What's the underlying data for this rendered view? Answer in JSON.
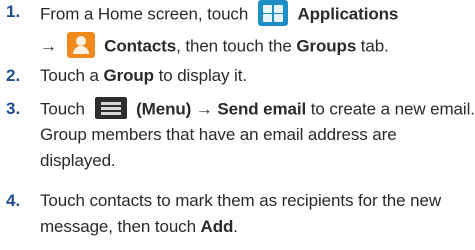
{
  "steps": [
    {
      "number": "1.",
      "line1": {
        "t1": "From a Home screen, touch",
        "b1": "Applications"
      },
      "line2": {
        "arrow": "→",
        "b1": "Contacts",
        "t1": ", then touch the ",
        "b2": "Groups",
        "t2": " tab."
      }
    },
    {
      "number": "2.",
      "line1": {
        "t1": "Touch a ",
        "b1": "Group",
        "t2": " to display it."
      }
    },
    {
      "number": "3.",
      "line1": {
        "t1": "Touch ",
        "b1": "(Menu)",
        "arrow": " → ",
        "b2": "Send email",
        "t2": " to create a new email."
      },
      "line2": "Group members that have an email address are",
      "line3": "displayed."
    },
    {
      "number": "4.",
      "line1": "Touch contacts to mark them as recipients for the new",
      "line2": {
        "t1": "message, then touch ",
        "b1": "Add",
        "t2": "."
      }
    }
  ],
  "icons": {
    "applications": "applications-icon",
    "contacts": "contacts-icon",
    "menu": "menu-icon"
  },
  "colors": {
    "number": "#1e4e8c",
    "applications_icon": "#1e8fc4",
    "contacts_icon": "#f08a1c",
    "menu_icon": "#2e2e2e"
  }
}
